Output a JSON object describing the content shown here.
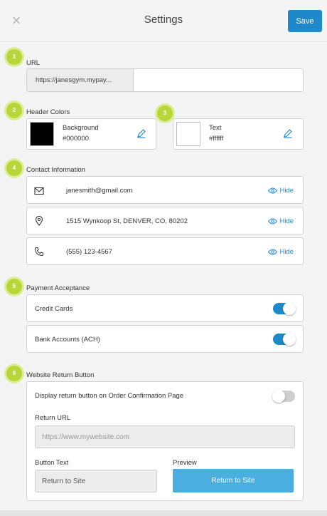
{
  "header": {
    "title": "Settings",
    "close_glyph": "×",
    "save_label": "Save"
  },
  "sections": {
    "url": {
      "badge": "1",
      "label": "URL",
      "prefix": "https://janesgym.mypay...",
      "value": ""
    },
    "header_colors": {
      "badge": "2",
      "label": "Header Colors",
      "background": {
        "name": "Background",
        "value": "#000000",
        "swatch": "#000000"
      },
      "text_badge": "3",
      "text": {
        "name": "Text",
        "value": "#ffffff",
        "swatch": "#ffffff"
      }
    },
    "contact": {
      "badge": "4",
      "label": "Contact Information",
      "items": [
        {
          "icon": "envelope-icon",
          "text": "janesmith@gmail.com",
          "action": "Hide"
        },
        {
          "icon": "location-pin-icon",
          "text": "1515 Wynkoop St, DENVER, CO, 80202",
          "action": "Hide"
        },
        {
          "icon": "phone-icon",
          "text": "(555) 123-4567",
          "action": "Hide"
        }
      ]
    },
    "payment": {
      "badge": "5",
      "label": "Payment Acceptance",
      "items": [
        {
          "text": "Credit Cards",
          "enabled": true
        },
        {
          "text": "Bank Accounts (ACH)",
          "enabled": true
        }
      ]
    },
    "return_button": {
      "badge": "6",
      "label": "Website Return Button",
      "display_label": "Display return button on Order Confirmation Page",
      "display_enabled": false,
      "return_url_label": "Return URL",
      "return_url_placeholder": "https://www.mywebsite.com",
      "button_text_label": "Button Text",
      "button_text_value": "Return to Site",
      "preview_label": "Preview",
      "preview_button": "Return to Site"
    }
  },
  "colors": {
    "accent": "#1e88c8",
    "badge": "#b8d63a",
    "preview_button": "#4aaee0"
  }
}
